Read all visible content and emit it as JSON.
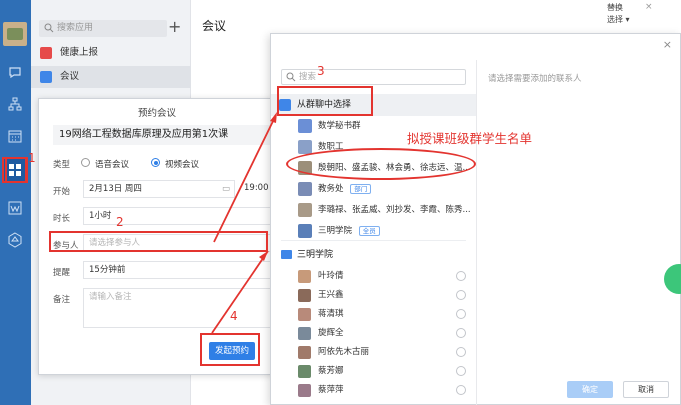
{
  "sidebar_rail": {
    "icons": [
      "chat-icon",
      "org-icon",
      "calendar-icon",
      "apps-icon",
      "doc-icon",
      "cube-icon"
    ]
  },
  "app_list": {
    "search_placeholder": "搜索应用",
    "add_symbol": "+",
    "items": [
      {
        "label": "健康上报",
        "color": "#e64a4a"
      },
      {
        "label": "会议",
        "color": "#3f86e8"
      }
    ]
  },
  "main": {
    "title": "会议",
    "corner_line1": "替换",
    "corner_line2": "选择 ▾"
  },
  "booking_dialog": {
    "title": "预约会议",
    "subject": "19网络工程数据库原理及应用第1次课",
    "type_label": "类型",
    "type_options": [
      "语音会议",
      "视频会议"
    ],
    "selected_type": "视频会议",
    "start_label": "开始",
    "start_date": "2月13日 周四",
    "start_time": "19:00",
    "duration_label": "时长",
    "duration_value": "1小时",
    "participants_label": "参与人",
    "participants_placeholder": "请选择参与人",
    "reminder_label": "提醒",
    "reminder_value": "15分钟前",
    "notes_label": "备注",
    "notes_placeholder": "请输入备注",
    "submit_label": "发起预约"
  },
  "contact_picker": {
    "close_symbol": "×",
    "search_placeholder": "搜索",
    "hint": "请选择需要添加的联系人",
    "group_chat_label": "从群聊中选择",
    "groups": [
      {
        "name": "数学秘书群",
        "tag": "",
        "color": "#6b8fd6"
      },
      {
        "name": "数职工",
        "tag": "",
        "color": "#8aa0c8"
      },
      {
        "name": "殷朝阳、盛孟骏、林会勇、徐志远、温...",
        "tag": "",
        "color": "#9c8f7a"
      },
      {
        "name": "教务处",
        "tag": "部门",
        "color": "#7a8cb5"
      },
      {
        "name": "李璐禄、张孟威、刘抄发、李霞、陈秀...",
        "tag": "",
        "color": "#a89a88"
      },
      {
        "name": "三明学院",
        "tag": "全员",
        "color": "#5a7fb8"
      }
    ],
    "folder_label": "三明学院",
    "people": [
      {
        "name": "叶玲倩",
        "color": "#c79a7a"
      },
      {
        "name": "王兴鑫",
        "color": "#8a6a5a"
      },
      {
        "name": "蒋清琪",
        "color": "#b88a7a"
      },
      {
        "name": "旋辉全",
        "color": "#7a8a9a"
      },
      {
        "name": "阿依先木古丽",
        "color": "#a07a6a"
      },
      {
        "name": "蔡芳娜",
        "color": "#6a8a6a"
      },
      {
        "name": "蔡萍萍",
        "color": "#9a7a8a"
      }
    ],
    "ok_label": "确定",
    "cancel_label": "取消"
  },
  "annotations": {
    "step1": "1",
    "step2": "2",
    "step3": "3",
    "step4": "4",
    "note": "拟授课班级群学生名单",
    "color": "#e3342f"
  }
}
